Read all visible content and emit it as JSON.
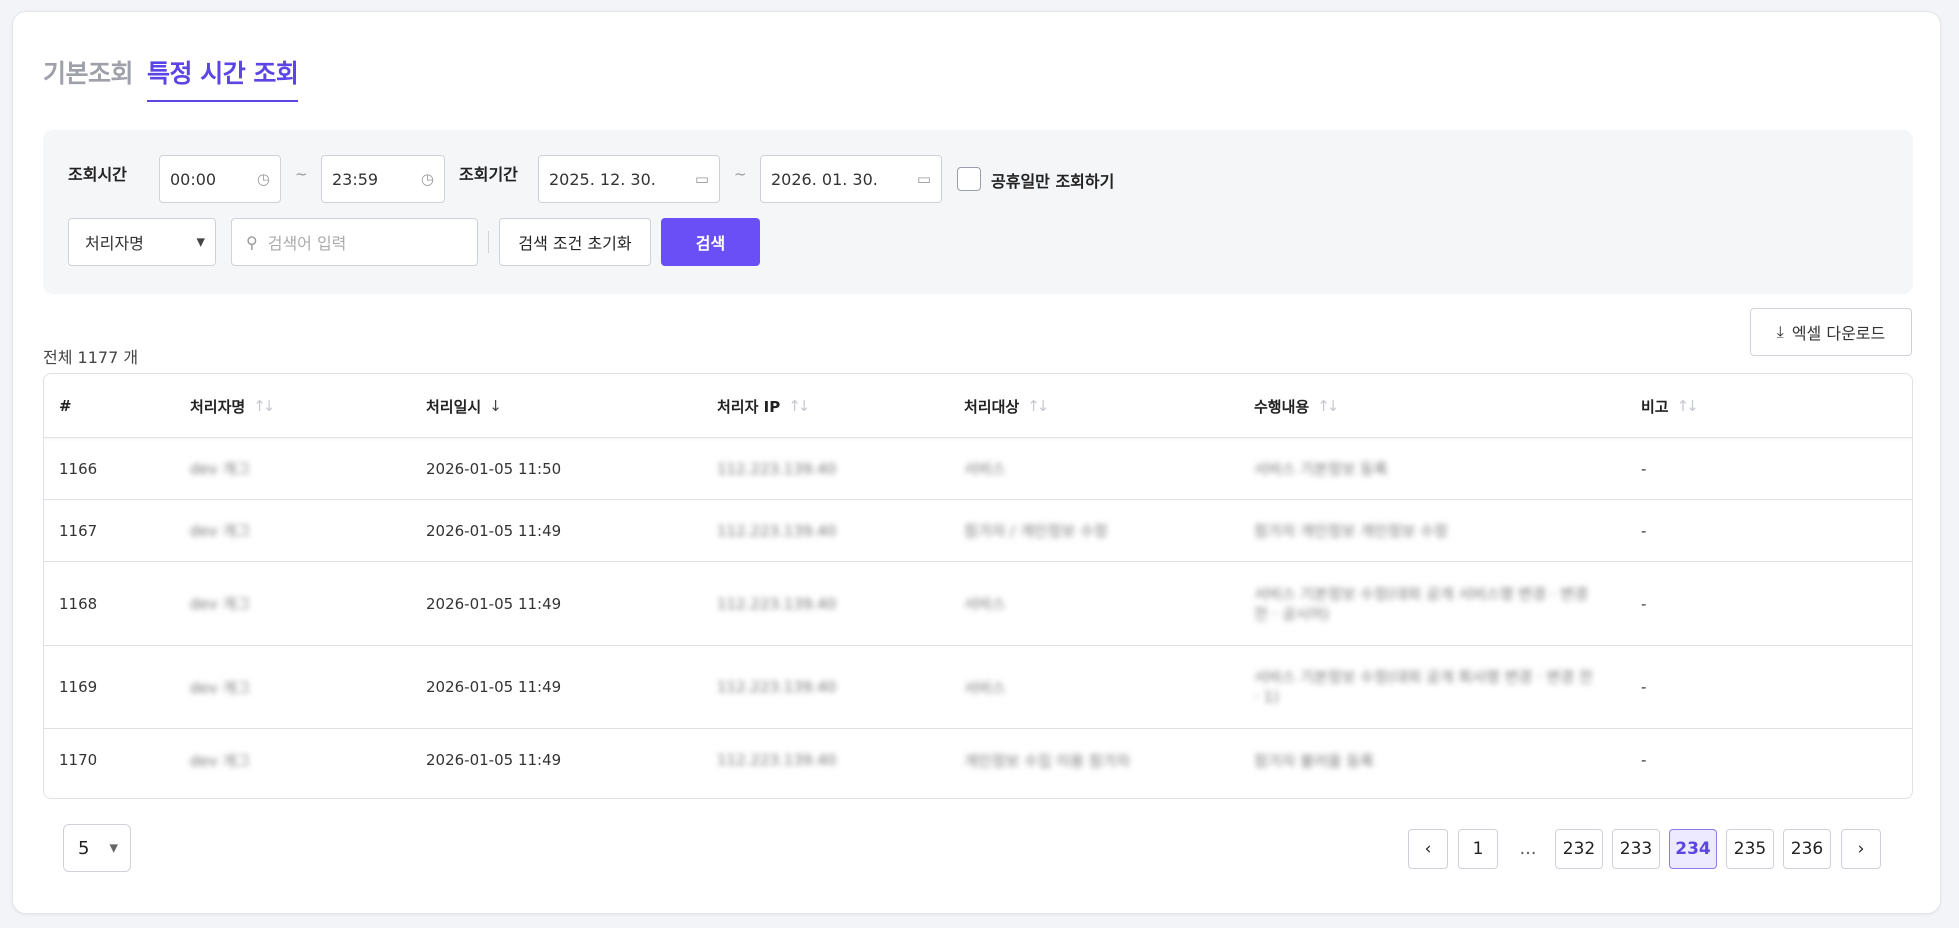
{
  "tabs": [
    {
      "label": "기본조회",
      "active": false
    },
    {
      "label": "특정 시간 조회",
      "active": true
    }
  ],
  "filter": {
    "time_label": "조회시간",
    "time_start": "00:00",
    "time_end": "23:59",
    "period_label": "조회기간",
    "date_start": "2025. 12. 30.",
    "date_end": "2026. 01. 30.",
    "tilde": "~",
    "holiday_only_label": "공휴일만 조회하기",
    "holiday_only_checked": false,
    "field_select": "처리자명",
    "search_placeholder": "검색어 입력",
    "reset_label": "검색 조건 초기화",
    "search_label": "검색"
  },
  "total_text": "전체 1177 개",
  "excel_label": "엑셀 다운로드",
  "table": {
    "headers": [
      "#",
      "처리자명",
      "처리일시",
      "처리자 IP",
      "처리대상",
      "수행내용",
      "비고"
    ],
    "rows": [
      {
        "no": "1166",
        "name": "dev 개그",
        "datetime": "2026-01-05 11:50",
        "ip": "112.223.139.40",
        "target": "서비스",
        "action": "서비스 기본정보 등록",
        "note": "-"
      },
      {
        "no": "1167",
        "name": "dev 개그",
        "datetime": "2026-01-05 11:49",
        "ip": "112.223.139.40",
        "target": "참가자 / 개인정보 수정",
        "action": "참가자 개인정보 개인정보 수정",
        "note": "-"
      },
      {
        "no": "1168",
        "name": "dev 개그",
        "datetime": "2026-01-05 11:49",
        "ip": "112.223.139.40",
        "target": "서비스",
        "action": "서비스 기본정보 수정(대외 공개 서비스명 변경 · 변경 전 · 공시어)",
        "note": "-"
      },
      {
        "no": "1169",
        "name": "dev 개그",
        "datetime": "2026-01-05 11:49",
        "ip": "112.223.139.40",
        "target": "서비스",
        "action": "서비스 기본정보 수정(대외 공개 회사명 변경 · 변경 전 · 1)",
        "note": "-"
      },
      {
        "no": "1170",
        "name": "dev 개그",
        "datetime": "2026-01-05 11:49",
        "ip": "112.223.139.40",
        "target": "개인정보 수집 이용 참가자",
        "action": "참가자 불러올 등록",
        "note": "-"
      }
    ]
  },
  "pagination": {
    "page_size": "5",
    "pages": [
      "1",
      "…",
      "232",
      "233",
      "234",
      "235",
      "236"
    ],
    "current": "234"
  },
  "colors": {
    "accent": "#5b45e6",
    "primary_button": "#6b4ff6"
  }
}
